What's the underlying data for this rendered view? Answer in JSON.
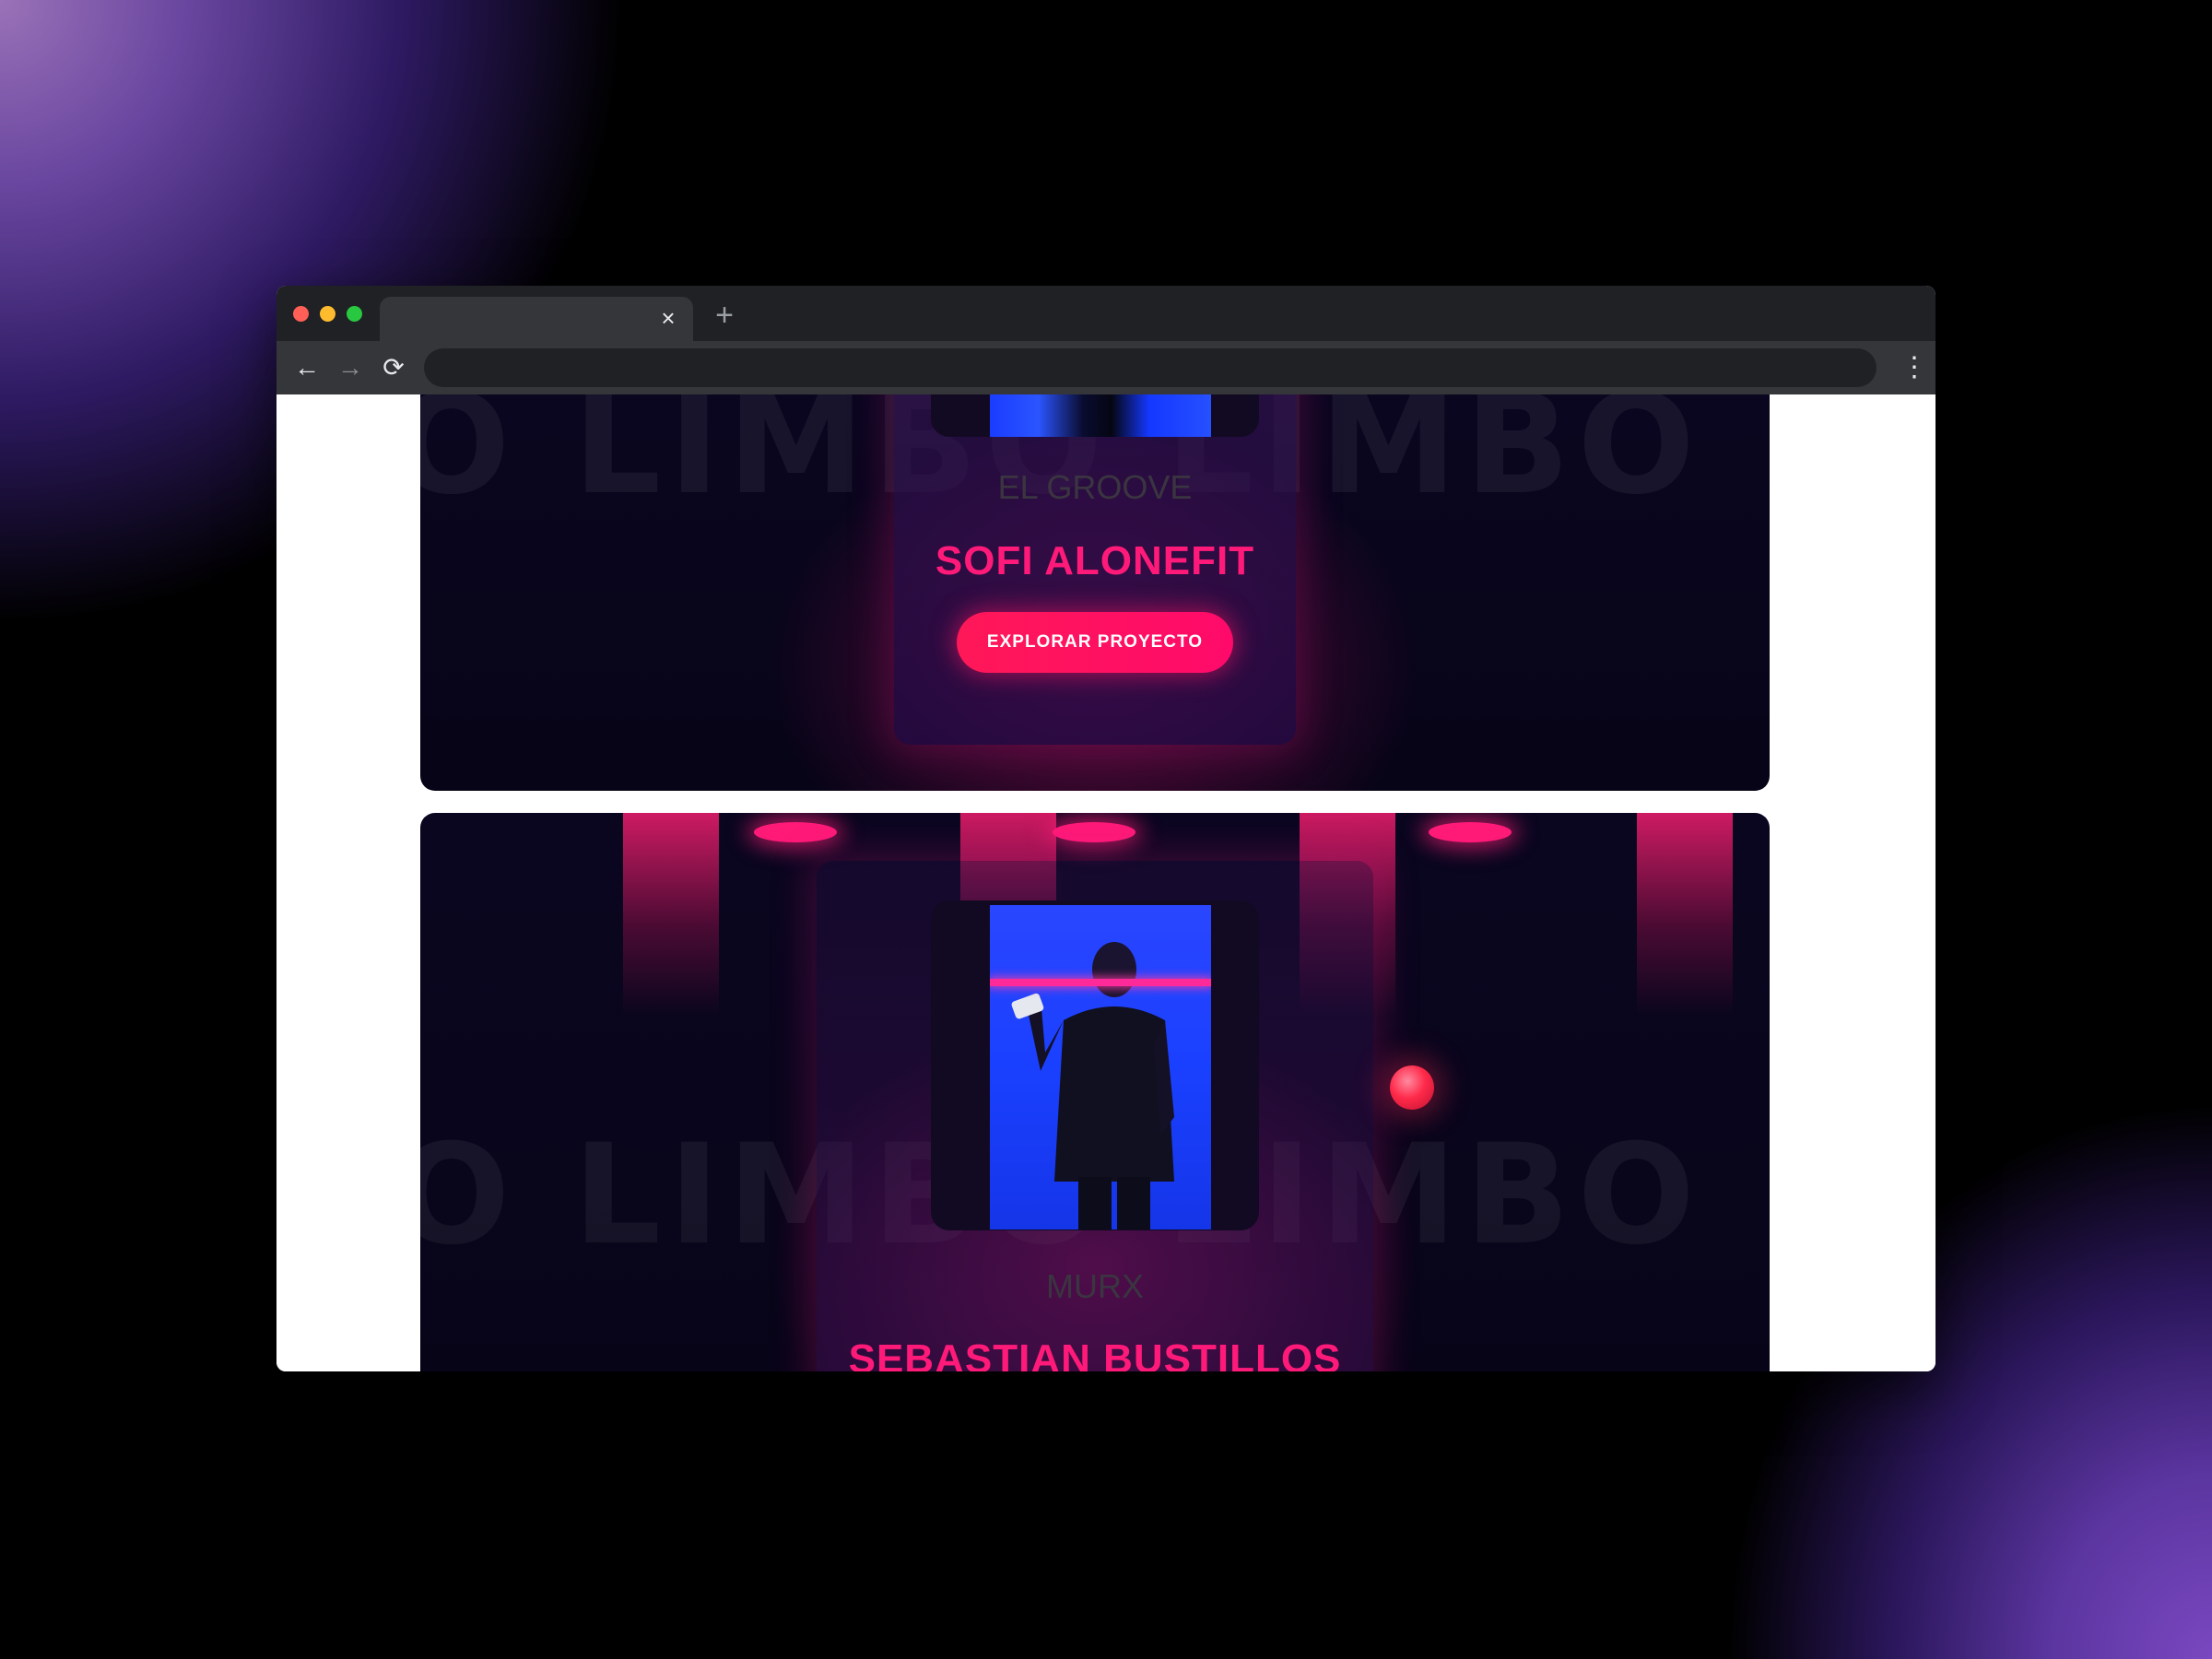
{
  "browser": {
    "tab_close_glyph": "×",
    "new_tab_glyph": "+",
    "back_glyph": "←",
    "forward_glyph": "→",
    "reload_glyph": "⟳",
    "menu_glyph": "⋮",
    "address_value": "",
    "icons": [
      "close-icon",
      "plus-icon",
      "arrow-left-icon",
      "arrow-right-icon",
      "reload-icon",
      "kebab-menu-icon"
    ]
  },
  "projects": [
    {
      "watermark": "O LIMBO LIMBO LIMBO LI",
      "subtitle": "EL GROOVE",
      "name": "SOFI ALONEFIT",
      "cta_label": "EXPLORAR PROYECTO"
    },
    {
      "watermark": "O LIMBO LIMBO LIMBO LI",
      "subtitle": "MURX",
      "name": "SEBASTIAN BUSTILLOS"
    }
  ],
  "colors": {
    "accent": "#ff1a7a",
    "cta": "#ff1858",
    "card_bg": "#0a0620",
    "photo_blue": "#1a40ff"
  }
}
